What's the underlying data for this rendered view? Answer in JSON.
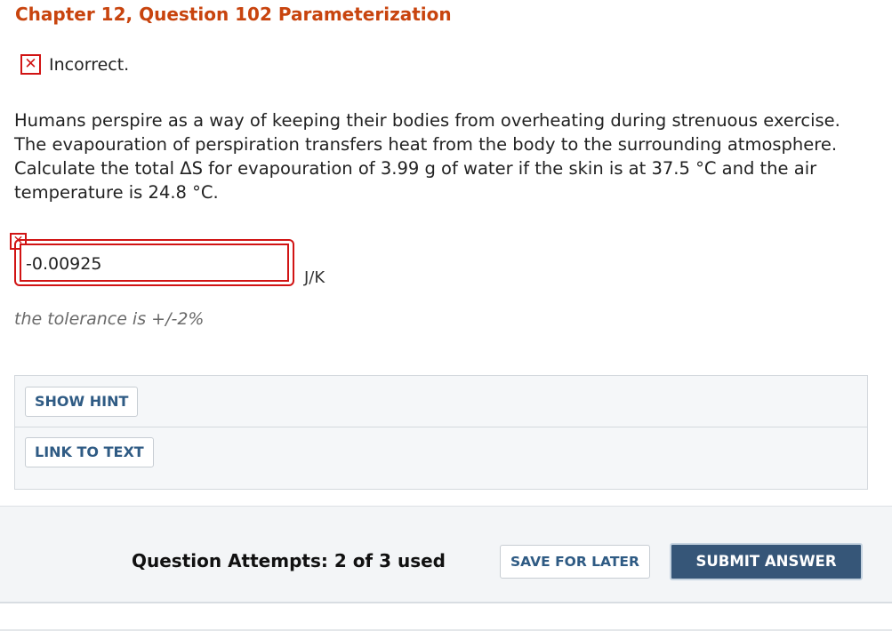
{
  "header": {
    "title": "Chapter 12, Question 102 Parameterization"
  },
  "status": {
    "icon": "x-mark-icon",
    "text": "Incorrect."
  },
  "question": {
    "text": "Humans perspire as a way of keeping their bodies from overheating during strenuous exercise. The evapouration of perspiration transfers heat from the body to the surrounding atmosphere. Calculate the total ΔS for evapouration of 3.99 g of water if the skin is at 37.5 °C and the air temperature is 24.8 °C."
  },
  "answer": {
    "value": "-0.00925",
    "unit": "J/K",
    "status_icon": "x-mark-icon",
    "tolerance": "the tolerance is +/-2%"
  },
  "hints": {
    "show_hint_label": "SHOW HINT",
    "link_to_text_label": "LINK TO TEXT"
  },
  "footer": {
    "attempts": "Question Attempts: 2 of 3 used",
    "save_label": "SAVE FOR LATER",
    "submit_label": "SUBMIT ANSWER"
  },
  "colors": {
    "title": "#c8440e",
    "error": "#d11414",
    "button_text": "#2f5b84",
    "submit_bg": "#365678"
  }
}
